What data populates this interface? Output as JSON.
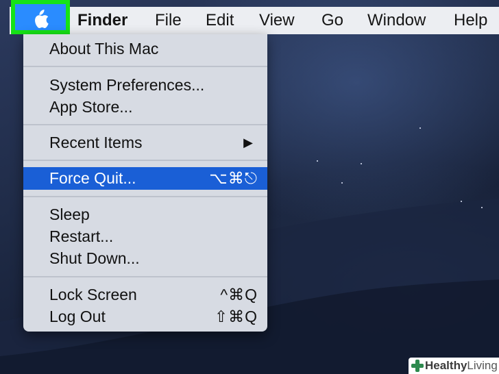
{
  "menubar": {
    "items": [
      {
        "label": "Finder",
        "bold": true
      },
      {
        "label": "File"
      },
      {
        "label": "Edit"
      },
      {
        "label": "View"
      },
      {
        "label": "Go"
      },
      {
        "label": "Window"
      },
      {
        "label": "Help"
      }
    ],
    "apple_icon": "apple-logo-icon",
    "highlight_color": "#16e316"
  },
  "apple_menu": {
    "items": [
      {
        "label": "About This Mac"
      },
      {
        "label": "System Preferences..."
      },
      {
        "label": "App Store..."
      },
      {
        "label": "Recent Items",
        "submenu_icon": "triangle-right-icon"
      },
      {
        "label": "Force Quit...",
        "shortcut": "⌥⌘⎋",
        "highlighted": true
      },
      {
        "label": "Sleep"
      },
      {
        "label": "Restart..."
      },
      {
        "label": "Shut Down..."
      },
      {
        "label": "Lock Screen",
        "shortcut": "^⌘Q"
      },
      {
        "label": "Log Out",
        "shortcut": "⇧⌘Q"
      }
    ],
    "selection_color": "#1a5fd6"
  },
  "watermark": {
    "part1": "Healthy",
    "part2": "Living"
  }
}
